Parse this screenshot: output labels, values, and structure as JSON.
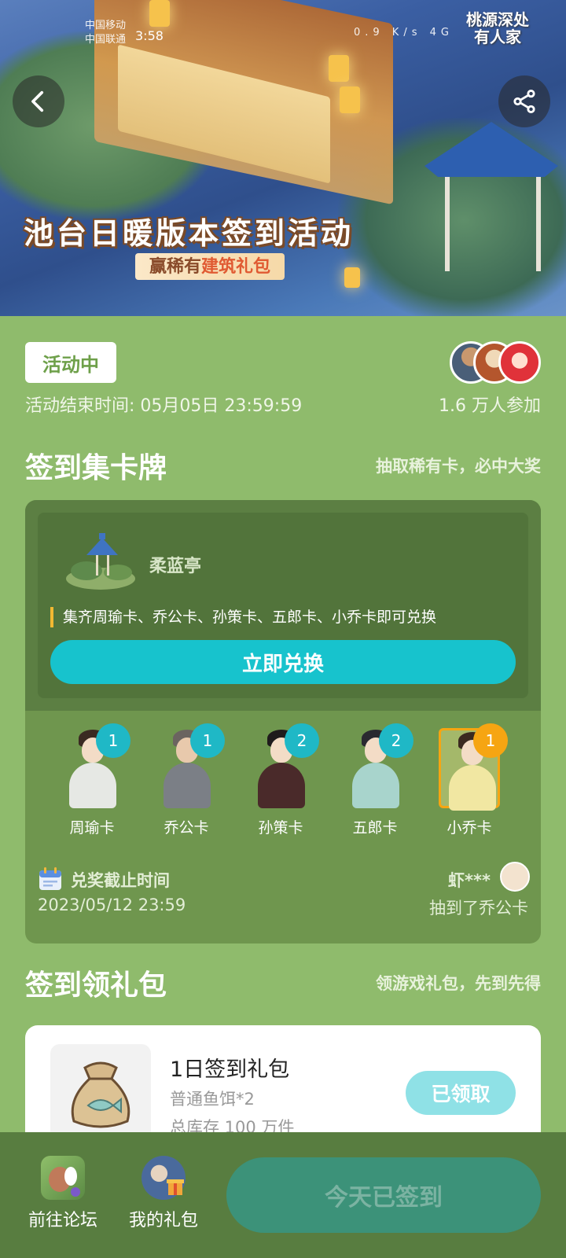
{
  "status_bar": {
    "carrier_1": "中国移动",
    "carrier_2": "中国联通",
    "time": "3:58",
    "indicators": "0.9 K/s  4G"
  },
  "banner": {
    "title": "池台日暖版本签到活动",
    "subtitle_prefix": "赢稀有",
    "subtitle_highlight": "建筑礼包",
    "logo_line1": "桃源深处",
    "logo_line2": "有人家"
  },
  "activity": {
    "status_badge": "活动中",
    "end_time": "活动结束时间: 05月05日 23:59:59",
    "participants": "1.6 万人参加"
  },
  "card_section": {
    "title": "签到集卡牌",
    "tip": "抽取稀有卡，必中大奖",
    "reward_name": "柔蓝亭",
    "rule": "集齐周瑜卡、乔公卡、孙策卡、五郎卡、小乔卡即可兑换",
    "exchange_button": "立即兑换",
    "cards": [
      {
        "label": "周瑜卡",
        "count": "1"
      },
      {
        "label": "乔公卡",
        "count": "1"
      },
      {
        "label": "孙策卡",
        "count": "2"
      },
      {
        "label": "五郎卡",
        "count": "2"
      },
      {
        "label": "小乔卡",
        "count": "1"
      }
    ],
    "deadline_label": "兑奖截止时间",
    "deadline_value": "2023/05/12 23:59",
    "winner_name": "虾***",
    "winner_text": "抽到了乔公卡"
  },
  "gift_section": {
    "title": "签到领礼包",
    "tip": "领游戏礼包，先到先得",
    "gift_title": "1日签到礼包",
    "gift_item": "普通鱼饵*2",
    "gift_stock": "总库存 100 万件",
    "claimed_button": "已领取"
  },
  "bottom_bar": {
    "forum_label": "前往论坛",
    "my_gifts_label": "我的礼包",
    "sign_button": "今天已签到"
  },
  "colors": {
    "page_bg": "#8fbb6c",
    "accent_cyan": "#17c3cd",
    "badge_orange": "#f6a512",
    "bottom_bar": "#587d40"
  }
}
